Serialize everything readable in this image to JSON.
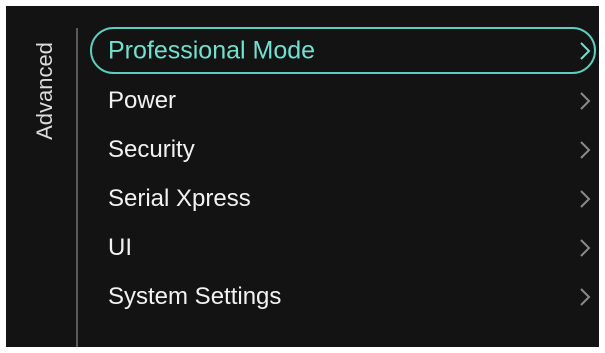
{
  "side_tab": {
    "label": "Advanced"
  },
  "menu": {
    "selected_index": 0,
    "items": [
      {
        "label": "Professional Mode",
        "icon": "chevron-right-icon"
      },
      {
        "label": "Power",
        "icon": "chevron-right-icon"
      },
      {
        "label": "Security",
        "icon": "chevron-right-icon"
      },
      {
        "label": "Serial Xpress",
        "icon": "chevron-right-icon"
      },
      {
        "label": "UI",
        "icon": "chevron-right-icon"
      },
      {
        "label": "System Settings",
        "icon": "chevron-right-icon"
      }
    ]
  },
  "colors": {
    "background": "#131313",
    "frame": "#ffffff",
    "text": "#f2f2f2",
    "accent": "#5fcdbd",
    "accent_text": "#72e0cf",
    "chevron": "#8a8a8a",
    "divider": "#5a5a5a"
  }
}
